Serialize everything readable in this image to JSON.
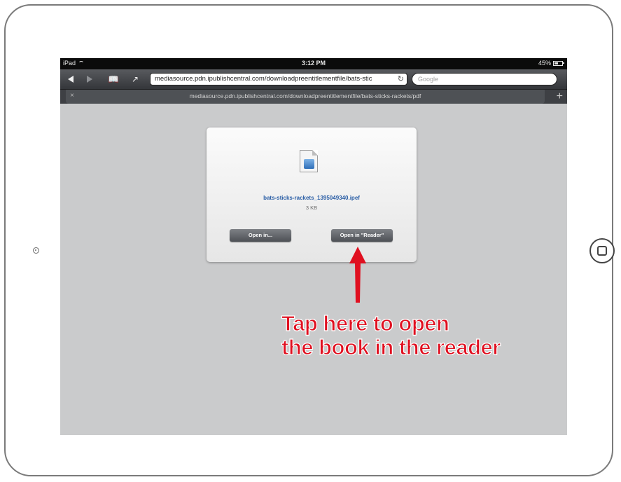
{
  "statusbar": {
    "device": "iPad",
    "time": "3:12 PM",
    "battery": "45%"
  },
  "toolbar": {
    "url": "mediasource.pdn.ipublishcentral.com/downloadpreentitlementfile/bats-stic",
    "search_placeholder": "Google"
  },
  "tab": {
    "title": "mediasource.pdn.ipublishcentral.com/downloadpreentitlementfile/bats-sticks-rackets/pdf",
    "close": "×",
    "new": "+"
  },
  "dialog": {
    "file_name": "bats-sticks-rackets_1395049340.ipef",
    "file_size": "3 KB",
    "open_in_label": "Open in...",
    "open_reader_label": "Open in \"Reader\""
  },
  "annotation": {
    "line1": "Tap here to open",
    "line2": "the book in the reader",
    "color": "#e01020"
  },
  "icons": [
    "wifi-icon",
    "battery-icon",
    "back-icon",
    "forward-icon",
    "bookmarks-icon",
    "share-icon",
    "reload-icon",
    "tab-close-icon",
    "new-tab-icon",
    "file-icon",
    "camera-icon",
    "home-button-icon"
  ]
}
